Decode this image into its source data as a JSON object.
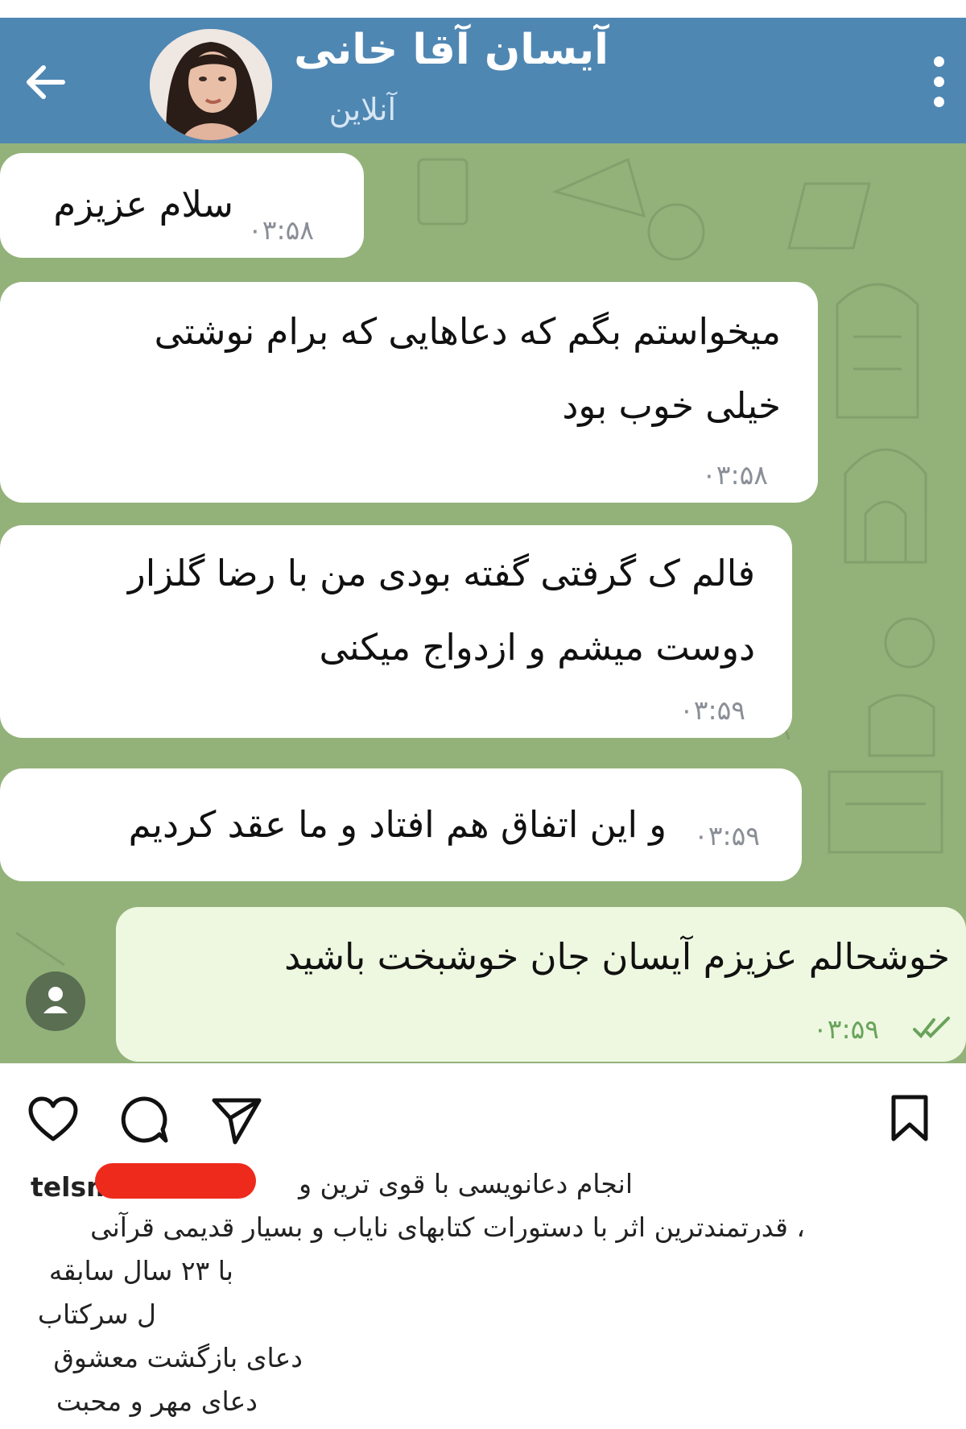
{
  "header": {
    "contact_name": "آیسان آقا خانی",
    "status": "آنلاین",
    "back_icon": "arrow-left-icon",
    "menu_icon": "vertical-dots-icon",
    "color": "#4f87b3"
  },
  "chat": {
    "background_color": "#93b27a",
    "messages": [
      {
        "text": "سلام عزیزم",
        "time": "۰۳:۵۸",
        "direction": "incoming"
      },
      {
        "text": "میخواستم بگم که دعاهایی که برام نوشتی\nخیلی خوب بود",
        "time": "۰۳:۵۸",
        "direction": "incoming"
      },
      {
        "text": "فالم ک گرفتی گفته بودی من با رضا گلزار\nدوست میشم و ازدواج میکنی",
        "time": "۰۳:۵۹",
        "direction": "incoming"
      },
      {
        "text": "و این اتفاق هم افتاد و ما عقد کردیم",
        "time": "۰۳:۵۹",
        "direction": "incoming"
      },
      {
        "text": "خوشحالم عزیزم آیسان جان  خوشبخت باشید",
        "time": "۰۳:۵۹",
        "direction": "outgoing",
        "status_icon": "double-check-icon"
      }
    ]
  },
  "post_actions": {
    "like_icon": "heart-icon",
    "comment_icon": "comment-icon",
    "share_icon": "send-icon",
    "save_icon": "bookmark-icon"
  },
  "caption": {
    "username": "telsm",
    "lines": [
      "انجام دعانویسی با قوی ترین و",
      "، قدرتمندترین اثر با دستورات کتابهای نایاب و بسیار قدیمی قرآنی",
      "با ۲۳ سال سابقه",
      "ل سرکتاب",
      "دعای بازگشت معشوق",
      "دعای مهر و محبت"
    ]
  }
}
